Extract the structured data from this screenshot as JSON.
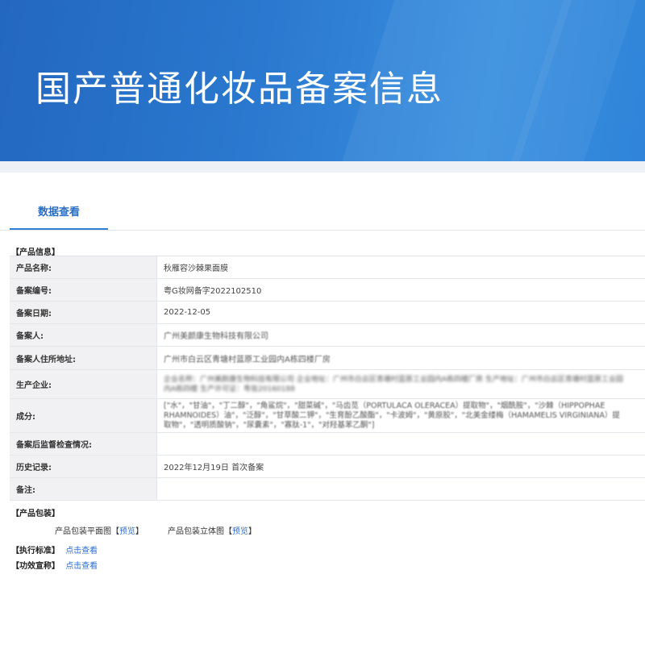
{
  "banner": {
    "title": "国产普通化妆品备案信息"
  },
  "tabs": [
    {
      "label": "数据查看",
      "active": true
    }
  ],
  "product_info": {
    "section_label": "【产品信息】",
    "rows": [
      {
        "label": "产品名称:",
        "value": "秋雁容沙棘果面膜"
      },
      {
        "label": "备案编号:",
        "value": "粤G妆网备字2022102510"
      },
      {
        "label": "备案日期:",
        "value": "2022-12-05"
      },
      {
        "label": "备案人:",
        "value": "广州美颜康生物科技有限公司"
      },
      {
        "label": "备案人住所地址:",
        "value": "广州市白云区青塘村蓝原工业园内A栋四楼厂房"
      },
      {
        "label": "生产企业:",
        "value": "企业名称：广州美颜康生物科技有限公司 企业地址：广州市白云区青塘村蓝原工业园内A栋四楼厂房 生产地址：广州市白云区青塘村蓝原工业园内A栋四楼 生产许可证：粤妆20160188"
      },
      {
        "label": "成分:",
        "value": "[\"水\"，\"甘油\"，\"丁二醇\"，\"角鲨烷\"，\"甜菜碱\"，\"马齿苋（PORTULACA OLERACEA）提取物\"，\"烟酰胺\"，\"沙棘（HIPPOPHAE RHAMNOIDES）油\"，\"泛醇\"，\"甘草酸二钾\"，\"生育酚乙酸酯\"，\"卡波姆\"，\"黄原胶\"，\"北美金缕梅（HAMAMELIS VIRGINIANA）提取物\"，\"透明质酸钠\"，\"尿囊素\"，\"寡肽-1\"，\"对羟基苯乙酮\"]"
      },
      {
        "label": "备案后监督检查情况:",
        "value": ""
      },
      {
        "label": "历史记录:",
        "value": "2022年12月19日 首次备案"
      },
      {
        "label": "备注:",
        "value": ""
      }
    ]
  },
  "packaging": {
    "section_label": "【产品包装】",
    "items": [
      {
        "label": "产品包装平面图",
        "bracket_open": "【",
        "link": "预览",
        "bracket_close": "】"
      },
      {
        "label": "产品包装立体图",
        "bracket_open": "【",
        "link": "预览",
        "bracket_close": "】"
      }
    ]
  },
  "standard": {
    "label": "【执行标准】",
    "link": "点击查看"
  },
  "efficacy": {
    "label": "【功效宣称】",
    "link": "点击查看"
  }
}
